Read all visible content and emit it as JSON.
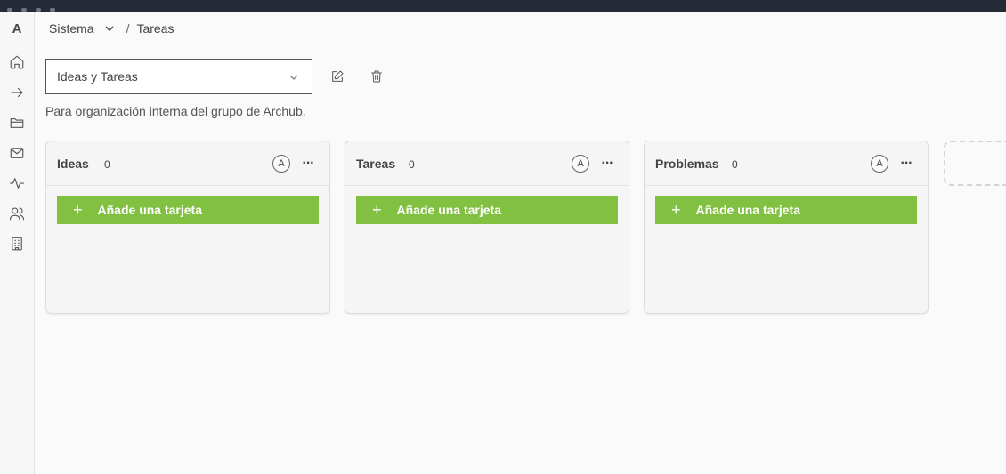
{
  "sidebar": {
    "logo": "A",
    "icons": [
      "home-icon",
      "arrow-right-icon",
      "folder-icon",
      "mail-icon",
      "activity-icon",
      "users-icon",
      "building-icon"
    ]
  },
  "header": {
    "breadcrumb_root": "Sistema",
    "breadcrumb_separator": "/",
    "breadcrumb_current": "Tareas"
  },
  "board": {
    "selected": "Ideas y Tareas",
    "description": "Para organización interna del grupo de Archub."
  },
  "columns": [
    {
      "title": "Ideas",
      "count": "0",
      "avatar": "A",
      "add_label": "Añade una tarjeta"
    },
    {
      "title": "Tareas",
      "count": "0",
      "avatar": "A",
      "add_label": "Añade una tarjeta"
    },
    {
      "title": "Problemas",
      "count": "0",
      "avatar": "A",
      "add_label": "Añade una tarjeta"
    }
  ],
  "colors": {
    "accent_green": "#82c042",
    "topbar": "#252b36"
  }
}
